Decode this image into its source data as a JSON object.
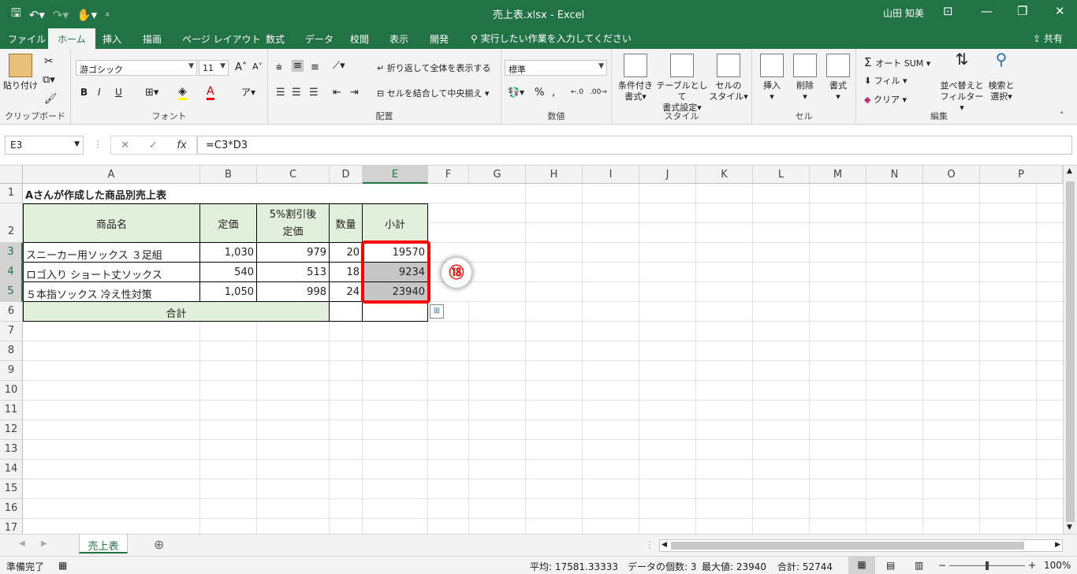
{
  "window": {
    "title": "売上表.xlsx  -  Excel",
    "user": "山田 知美"
  },
  "menu": {
    "tabs": [
      "ファイル",
      "ホーム",
      "挿入",
      "描画",
      "ページ レイアウト",
      "数式",
      "データ",
      "校閲",
      "表示",
      "開発"
    ],
    "active": "ホーム",
    "tell_me": "実行したい作業を入力してください",
    "share": "共有"
  },
  "ribbon": {
    "clipboard": {
      "label": "クリップボード",
      "paste": "貼り付け"
    },
    "font": {
      "label": "フォント",
      "name": "游ゴシック",
      "size": "11",
      "bold": "B",
      "italic": "I",
      "underline": "U"
    },
    "alignment": {
      "label": "配置",
      "wrap": "折り返して全体を表示する",
      "merge": "セルを結合して中央揃え"
    },
    "number": {
      "label": "数値",
      "format": "標準"
    },
    "styles": {
      "label": "スタイル",
      "conditional": "条件付き",
      "conditional2": "書式",
      "table": "テーブルとして",
      "table2": "書式設定",
      "cell": "セルの",
      "cell2": "スタイル"
    },
    "cells": {
      "label": "セル",
      "insert": "挿入",
      "delete": "削除",
      "format": "書式"
    },
    "editing": {
      "label": "編集",
      "autosum": "オート SUM",
      "fill": "フィル",
      "clear": "クリア",
      "sort": "並べ替えと",
      "sort2": "フィルター",
      "find": "検索と",
      "find2": "選択"
    }
  },
  "formula_bar": {
    "name_box": "E3",
    "formula": "=C3*D3"
  },
  "columns": [
    "A",
    "B",
    "C",
    "D",
    "E",
    "F",
    "G",
    "H",
    "I",
    "J",
    "K",
    "L",
    "M",
    "N",
    "O",
    "P"
  ],
  "rows": [
    "1",
    "2",
    "3",
    "4",
    "5",
    "6",
    "7",
    "8",
    "9",
    "10",
    "11",
    "12",
    "13",
    "14",
    "15",
    "16",
    "17"
  ],
  "sheet": {
    "a1": "Aさんが作成した商品別売上表",
    "headers": {
      "name": "商品名",
      "price": "定価",
      "discount1": "5%割引後",
      "discount2": "定価",
      "qty": "数量",
      "subtotal": "小計"
    },
    "data": [
      {
        "name": "スニーカー用ソックス ３足組",
        "price": "1,030",
        "disc": "979",
        "qty": "20",
        "sub": "19570"
      },
      {
        "name": "ロゴ入り ショート丈ソックス",
        "price": "540",
        "disc": "513",
        "qty": "18",
        "sub": "9234"
      },
      {
        "name": "５本指ソックス 冷え性対策",
        "price": "1,050",
        "disc": "998",
        "qty": "24",
        "sub": "23940"
      }
    ],
    "total_label": "合計"
  },
  "annotation": "⑱",
  "sheet_tabs": [
    "売上表"
  ],
  "status": {
    "ready": "準備完了",
    "average": "平均: 17581.33333",
    "count": "データの個数: 3",
    "max": "最大値: 23940",
    "sum": "合計: 52744",
    "zoom": "100%"
  },
  "colors": {
    "accent": "#217346",
    "header_fill": "#e2efda",
    "selected_fill": "#c6c6c6",
    "highlight": "#ff0000"
  }
}
